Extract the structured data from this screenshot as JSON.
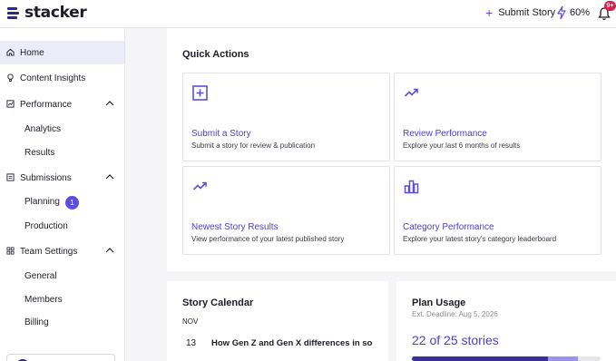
{
  "header": {
    "logo_text": "stacker",
    "submit_label": "Submit Story",
    "usage_pct": "60%",
    "notif_badge": "9+"
  },
  "sidebar": {
    "home": "Home",
    "content_insights": "Content Insights",
    "performance": "Performance",
    "analytics": "Analytics",
    "results": "Results",
    "submissions": "Submissions",
    "planning": "Planning",
    "planning_count": "1",
    "production": "Production",
    "team_settings": "Team Settings",
    "general": "General",
    "members": "Members",
    "billing": "Billing"
  },
  "quick_actions": {
    "title": "Quick Actions",
    "cards": [
      {
        "title": "Submit a Story",
        "desc": "Submit a story for review & publication",
        "icon": "plus-square-icon"
      },
      {
        "title": "Review Performance",
        "desc": "Explore your last 6 months of results",
        "icon": "trending-up-icon"
      },
      {
        "title": "Newest Story Results",
        "desc": "View performance of your latest published story",
        "icon": "trending-up-icon"
      },
      {
        "title": "Category Performance",
        "desc": "Explore your latest story's category leaderboard",
        "icon": "bar-chart-icon"
      }
    ]
  },
  "calendar": {
    "title": "Story Calendar",
    "month": "NOV",
    "day": "13",
    "story": "How Gen Z and Gen X differences in social r"
  },
  "plan": {
    "title": "Plan Usage",
    "deadline": "Ext. Deadline: Aug 5, 2026",
    "stories": "22 of 25 stories",
    "used_fraction": 0.72,
    "pending_fraction": 0.16
  },
  "colors": {
    "accent": "#4a3fd1",
    "badge": "#d0264b"
  }
}
